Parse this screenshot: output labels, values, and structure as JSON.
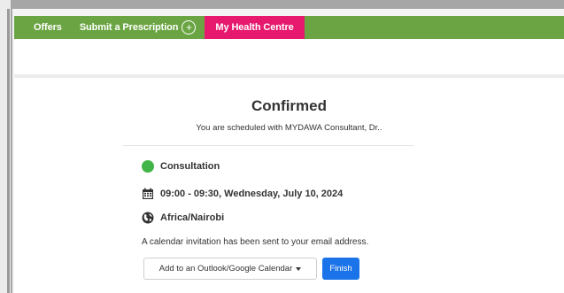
{
  "nav": {
    "items": [
      {
        "label": "Offers"
      },
      {
        "label": "Submit a Prescription"
      },
      {
        "label": "My Health Centre"
      }
    ]
  },
  "confirmation": {
    "title": "Confirmed",
    "subtitle": "You are scheduled with MYDAWA Consultant, Dr..",
    "event_name": "Consultation",
    "datetime": "09:00 - 09:30, Wednesday, July 10, 2024",
    "timezone": "Africa/Nairobi",
    "info": "A calendar invitation has been sent to your email address.",
    "add_calendar_label": "Add to an Outlook/Google Calendar",
    "finish_label": "Finish"
  },
  "colors": {
    "nav_green": "#6ba543",
    "active_pink": "#e6196e",
    "status_green": "#42b548",
    "primary_blue": "#1a73e8"
  }
}
